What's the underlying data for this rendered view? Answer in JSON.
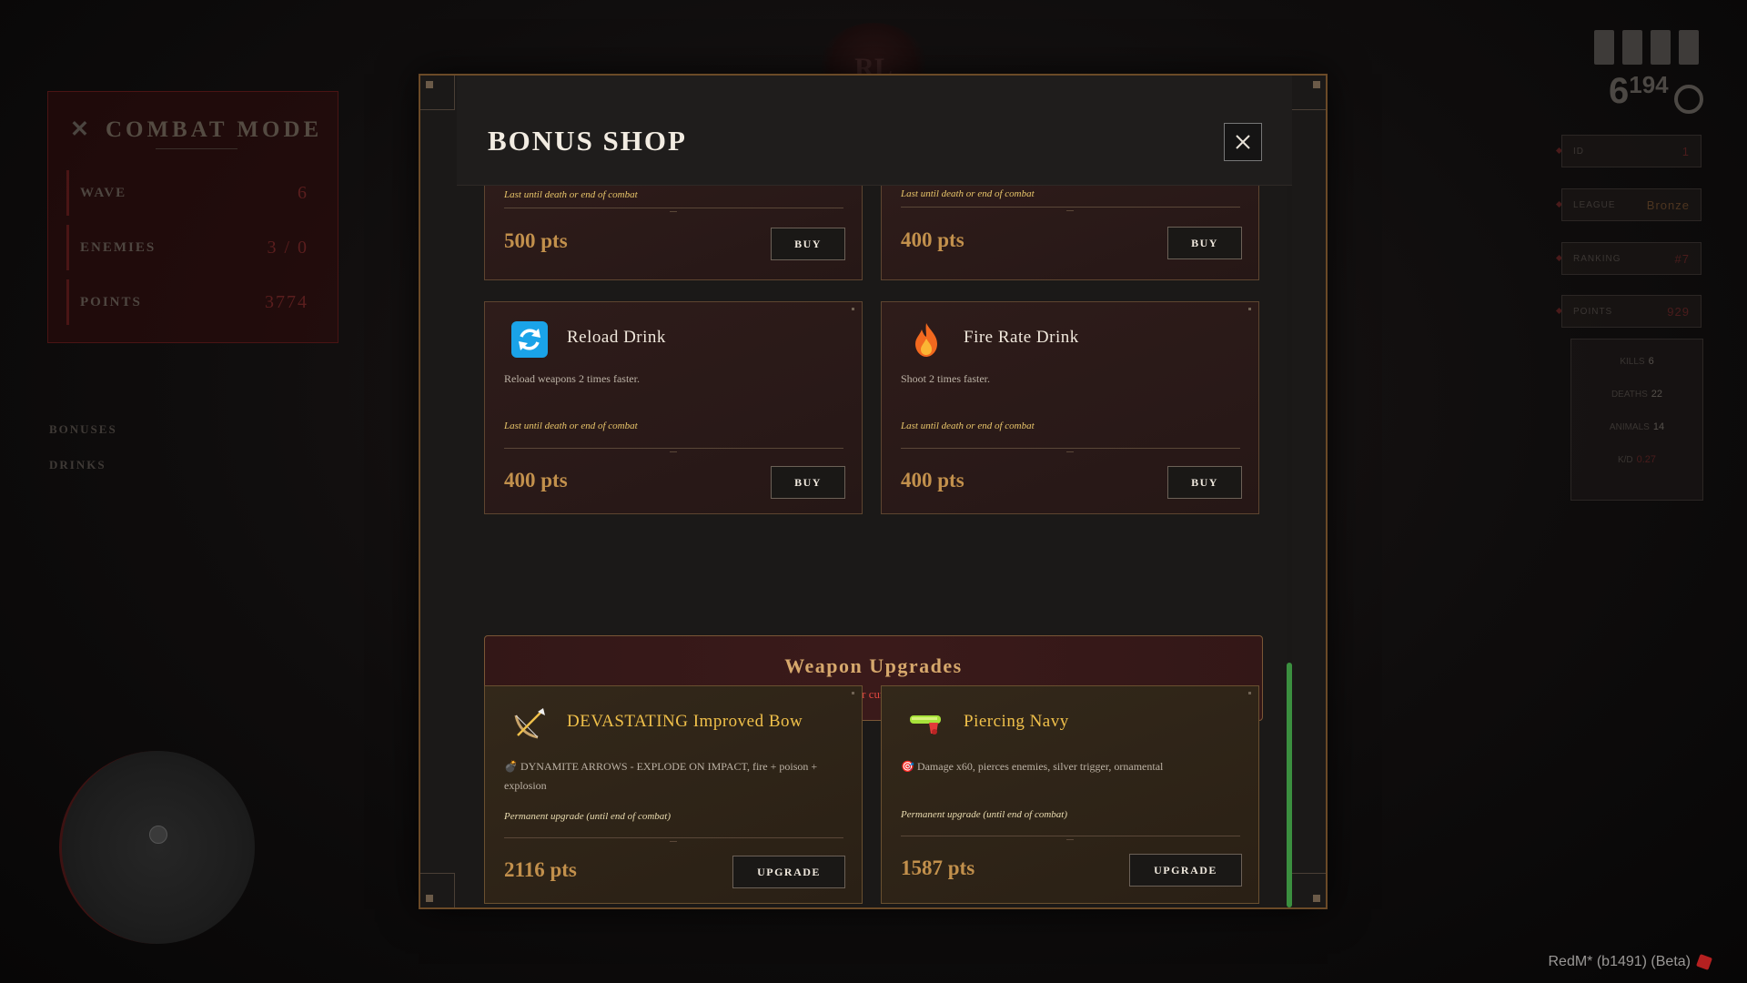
{
  "background": {
    "combat_mode": {
      "title": "COMBAT MODE",
      "rows": [
        {
          "label": "WAVE",
          "value": "6"
        },
        {
          "label": "ENEMIES",
          "value": "3 / 0"
        },
        {
          "label": "POINTS",
          "value": "3774"
        }
      ],
      "links": [
        "BONUSES",
        "DRINKS"
      ]
    },
    "emblem_text": "RL",
    "score": {
      "main": "6",
      "sup": "194"
    },
    "stat_boxes": [
      {
        "label": "ID",
        "value": "1"
      },
      {
        "label": "LEAGUE",
        "value": "Bronze"
      },
      {
        "label": "RANKING",
        "value": "#7"
      },
      {
        "label": "POINTS",
        "value": "929"
      }
    ],
    "stats": [
      {
        "label": "KILLS",
        "value": "6"
      },
      {
        "label": "DEATHS",
        "value": "22"
      },
      {
        "label": "ANIMALS",
        "value": "14"
      },
      {
        "label": "K/D",
        "value": "0.27"
      }
    ],
    "version": "RedM* (b1491) (Beta)"
  },
  "modal": {
    "title": "BONUS SHOP",
    "close_icon": "close-icon",
    "top_cards": [
      {
        "note": "Last until death or end of combat",
        "price": "500 pts",
        "button": "BUY"
      },
      {
        "note": "Last until death or end of combat",
        "price": "400 pts",
        "button": "BUY"
      }
    ],
    "drink_cards": [
      {
        "icon": "reload-icon",
        "name": "Reload Drink",
        "description": "Reload weapons 2 times faster.",
        "note": "Last until death or end of combat",
        "price": "400 pts",
        "button": "BUY"
      },
      {
        "icon": "fire-icon",
        "name": "Fire Rate Drink",
        "description": "Shoot 2 times faster.",
        "note": "Last until death or end of combat",
        "price": "400 pts",
        "button": "BUY"
      }
    ],
    "section": {
      "title": "Weapon Upgrades",
      "subtitle": "Upgrade your current weapons"
    },
    "upgrade_cards": [
      {
        "icon": "bow-icon",
        "name": "DEVASTATING Improved Bow",
        "description": "💣 DYNAMITE ARROWS - EXPLODE ON IMPACT, fire + poison + explosion",
        "note": "Permanent upgrade (until end of combat)",
        "price": "2116 pts",
        "button": "UPGRADE"
      },
      {
        "icon": "pistol-icon",
        "name": "Piercing Navy",
        "description": "🎯 Damage x60, pierces enemies, silver trigger, ornamental",
        "note": "Permanent upgrade (until end of combat)",
        "price": "1587 pts",
        "button": "UPGRADE"
      }
    ]
  },
  "colors": {
    "accent_gold": "#c2904c",
    "scroll_green": "#3b8f3f",
    "subtitle_red": "#e0483f"
  }
}
